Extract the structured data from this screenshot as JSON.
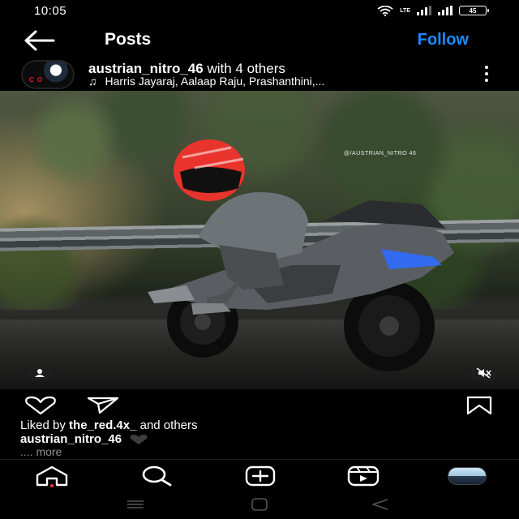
{
  "status_bar": {
    "time": "10:05",
    "network_label": "LTE",
    "battery_level": "45"
  },
  "header": {
    "title": "Posts",
    "follow_label": "Follow"
  },
  "post": {
    "author": "austrian_nitro_46",
    "with_text": "with 4 others",
    "music": "Harris Jayaraj, Aalaap Raju, Prashanthini,...",
    "watermark": "@/AUSTRIAN_NITRO 46",
    "avatar_text": "C O"
  },
  "engagement": {
    "liked_prefix": "Liked by",
    "liked_user": "the_red.4x_",
    "liked_suffix": "and others",
    "caption_user": "austrian_nitro_46",
    "more_label": ".... more"
  },
  "icons": {
    "back": "arrow-left",
    "more": "vertical-dots",
    "like": "heart-outline",
    "share": "paper-plane",
    "save": "bookmark",
    "home": "home",
    "search": "search",
    "create": "plus-square",
    "reels": "reels",
    "tag": "person",
    "mute": "speaker-off"
  },
  "colors": {
    "follow": "#1a8cff",
    "background": "#000000",
    "muted_text": "#8e8e8e",
    "notification_dot": "#ff3040",
    "helmet": "#e8342c"
  }
}
